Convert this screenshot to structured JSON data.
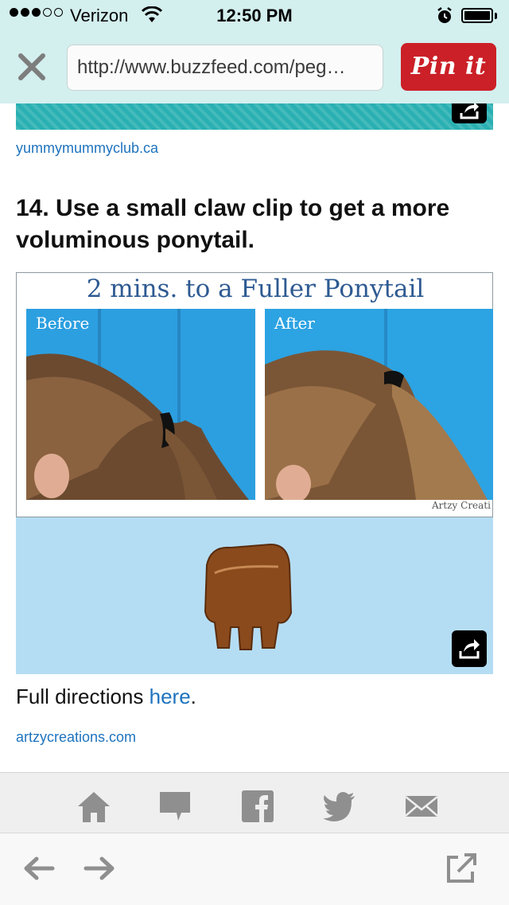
{
  "status_bar": {
    "carrier": "Verizon",
    "time": "12:50 PM"
  },
  "browser": {
    "url": "http://www.buzzfeed.com/peg…",
    "pin_label": "Pin it"
  },
  "article": {
    "prev_source": "yummymummyclub.ca",
    "heading": "14. Use a small claw clip to get a more voluminous ponytail.",
    "image_title": "2 mins. to a Fuller Ponytail",
    "before_label": "Before",
    "after_label": "After",
    "watermark": "Artzy Creati",
    "directions_text": "Full directions ",
    "directions_link": "here",
    "directions_end": ".",
    "source": "artzycreations.com"
  },
  "icons": [
    "close-icon",
    "share-icon",
    "home-icon",
    "comment-icon",
    "facebook-icon",
    "twitter-icon",
    "mail-icon",
    "back-arrow-icon",
    "forward-arrow-icon",
    "open-external-icon"
  ],
  "colors": {
    "accent": "#1e73be",
    "pin_red": "#cb2027",
    "toolbar": "#d3efee"
  }
}
